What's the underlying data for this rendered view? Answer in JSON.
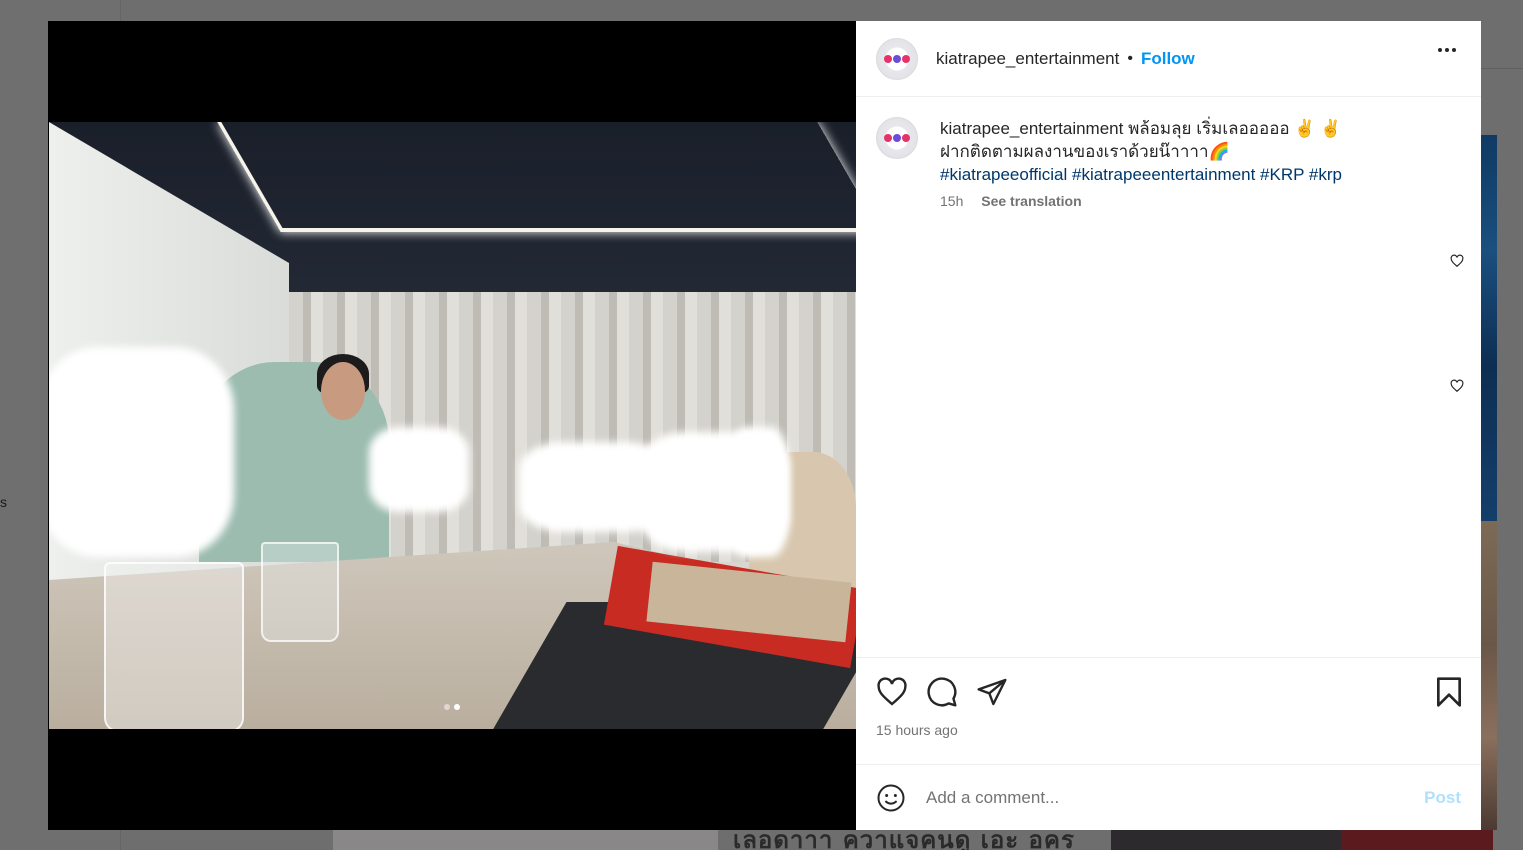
{
  "background": {
    "left_fragment": "s",
    "bottom_text": "เลอดาาา  ควาแจคนดู  เอะ อคร"
  },
  "post": {
    "username": "kiatrapee_entertainment",
    "separator": "•",
    "follow_label": "Follow",
    "more_label": "•••",
    "caption_user": "kiatrapee_entertainment",
    "caption_line1": " พล้อมลุย เริ่มเลอออออ ✌️ ✌️",
    "caption_line2": "ฝากติดตามผลงานของเราด้วยน๊าาาา🌈",
    "hashtags": "#kiatrapeeofficial #kiatrapeeentertainment #KRP #krp",
    "caption_age": "15h",
    "see_translation": "See translation",
    "time_ago": "15 hours ago",
    "comment_placeholder": "Add a comment...",
    "post_label": "Post",
    "carousel_current": 2,
    "carousel_total": 2
  },
  "icons": {
    "like": "heart-icon",
    "comment": "comment-icon",
    "share": "share-icon",
    "save": "bookmark-icon",
    "emoji": "emoji-icon",
    "more": "more-options-icon"
  },
  "colors": {
    "follow_blue": "#0095f6",
    "hashtag": "#00376b",
    "post_disabled": "#b2dffc",
    "muted_text": "#737373"
  }
}
